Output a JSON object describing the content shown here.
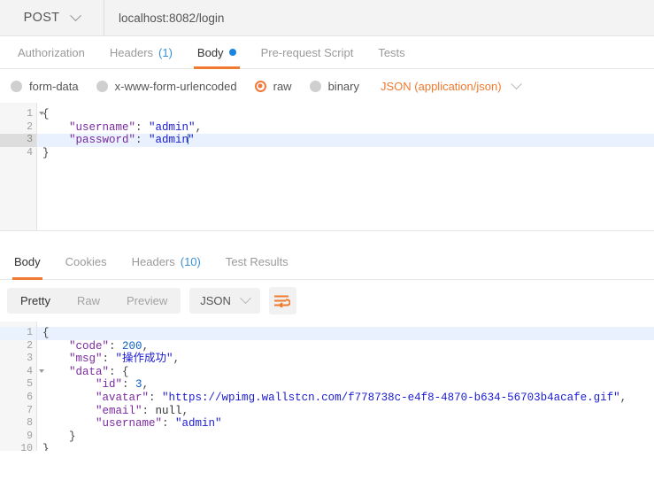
{
  "request": {
    "method": "POST",
    "url": "localhost:8082/login",
    "tabs": [
      {
        "label": "Authorization",
        "active": false
      },
      {
        "label": "Headers",
        "count": "(1)",
        "active": false
      },
      {
        "label": "Body",
        "active": true,
        "dot": true
      },
      {
        "label": "Pre-request Script",
        "active": false
      },
      {
        "label": "Tests",
        "active": false
      }
    ],
    "body_types": [
      {
        "label": "form-data",
        "selected": false
      },
      {
        "label": "x-www-form-urlencoded",
        "selected": false
      },
      {
        "label": "raw",
        "selected": true
      },
      {
        "label": "binary",
        "selected": false
      }
    ],
    "content_type": "JSON (application/json)",
    "editor_lines": [
      {
        "num": "1",
        "fold": true,
        "active": false
      },
      {
        "num": "2",
        "fold": false,
        "active": false
      },
      {
        "num": "3",
        "fold": false,
        "active": true
      },
      {
        "num": "4",
        "fold": false,
        "active": false
      }
    ],
    "code": {
      "l1": "{",
      "l2_key": "\"username\"",
      "l2_val": "\"admin\"",
      "l3_key": "\"password\"",
      "l3_val_open": "\"admin",
      "l3_val_close": "\"",
      "l4": "}"
    }
  },
  "response": {
    "tabs": [
      {
        "label": "Body",
        "active": true
      },
      {
        "label": "Cookies",
        "active": false
      },
      {
        "label": "Headers",
        "count": "(10)",
        "active": false
      },
      {
        "label": "Test Results",
        "active": false
      }
    ],
    "view_modes": [
      {
        "label": "Pretty",
        "active": true
      },
      {
        "label": "Raw",
        "active": false
      },
      {
        "label": "Preview",
        "active": false
      }
    ],
    "format": "JSON",
    "wrap_icon": "word-wrap-icon",
    "editor_lines": [
      {
        "num": "1",
        "fold": true,
        "active": true
      },
      {
        "num": "2",
        "fold": false,
        "active": false
      },
      {
        "num": "3",
        "fold": false,
        "active": false
      },
      {
        "num": "4",
        "fold": true,
        "active": false
      },
      {
        "num": "5",
        "fold": false,
        "active": false
      },
      {
        "num": "6",
        "fold": false,
        "active": false
      },
      {
        "num": "7",
        "fold": false,
        "active": false
      },
      {
        "num": "8",
        "fold": false,
        "active": false
      },
      {
        "num": "9",
        "fold": false,
        "active": false
      },
      {
        "num": "10",
        "fold": false,
        "active": false
      }
    ],
    "code": {
      "l1": "{",
      "l2_key": "\"code\"",
      "l2_val": "200",
      "l3_key": "\"msg\"",
      "l3_val": "\"操作成功\"",
      "l4_key": "\"data\"",
      "l5_key": "\"id\"",
      "l5_val": "3",
      "l6_key": "\"avatar\"",
      "l6_val": "\"https://wpimg.wallstcn.com/f778738c-e4f8-4870-b634-56703b4acafe.gif\"",
      "l7_key": "\"email\"",
      "l7_val": "null",
      "l8_key": "\"username\"",
      "l8_val": "\"admin\"",
      "l9": "}",
      "l10": "}"
    }
  },
  "colors": {
    "accent_orange": "#ef7a30",
    "link_blue": "#3a8fd4",
    "dot_blue": "#1a85e0",
    "json_string": "#1a1ad1",
    "json_key": "#7a2aa0",
    "json_number": "#0b5fbe"
  }
}
